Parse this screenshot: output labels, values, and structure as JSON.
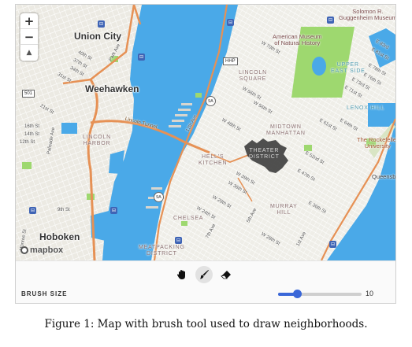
{
  "map": {
    "zoom_in": "+",
    "zoom_out": "−",
    "compass": "▲",
    "attribution": "mapbox",
    "labels": {
      "union_city": "Union City",
      "weehawken": "Weehawken",
      "hoboken": "Hoboken",
      "lincoln_tunnel": "Lincoln Tunnel",
      "lincoln_harbor": "LINCOLN\nHARBOR",
      "lincoln_square": "LINCOLN\nSQUARE",
      "upper_east_side": "UPPER\nEAST SIDE",
      "lenox_hill": "LENOX HILL",
      "midtown_manhattan": "MIDTOWN\nMANHATTAN",
      "theater_district": "THEATER\nDISTRICT",
      "hells_kitchen": "HELL'S\nKITCHEN",
      "murray_hill": "MURRAY\nHILL",
      "chelsea": "CHELSEA",
      "meatpacking_district": "MEATPACKING\nDISTRICT",
      "american_museum": "American Museum\nof Natural History",
      "guggenheim": "Solomon R.\nGuggenheim Museum",
      "rockefeller_university": "The Rockefeller\nUniversity",
      "queensbridge": "Queensb",
      "twelfth_ave": "12th Ave",
      "seventh_ave": "7th Ave",
      "fifth_ave": "5th Ave",
      "first_ave": "1st Ave",
      "park_ave": "Park Ave",
      "palisade_ave": "Palisade Ave",
      "monroe_st": "Monroe St",
      "s_40th": "40th St",
      "s_37th": "37th St",
      "s_34th": "34th St",
      "s_31st": "31st St",
      "s_21st": "21st St",
      "s_16th": "16th St",
      "s_14th": "14th St",
      "s_12th": "12th St",
      "s_9th": "9th St",
      "s_w70th": "W 70th St",
      "s_w66th": "W 66th St",
      "s_w56th": "W 56th St",
      "s_w48th": "W 48th St",
      "s_w39th": "W 39th St",
      "s_w36th": "W 36th St",
      "s_w29th": "W 29th St",
      "s_w24th": "W 24th St",
      "s_w28th": "W 28th St",
      "s_e83rd": "E 83rd",
      "s_e81st": "E 81st St",
      "s_e78th": "E 78th St",
      "s_e76th": "E 76th St",
      "s_e73rd": "E 73rd St",
      "s_e71st": "E 71st St",
      "s_e64th": "E 64th St",
      "s_e61st": "E 61st St",
      "s_e52nd": "E 52nd St",
      "s_e47th": "E 47th St",
      "s_e36th": "E 36th St",
      "shield_9a": "9A",
      "shield_501": "501",
      "shield_hhp": "HHP"
    },
    "colors": {
      "water": "#4aa9e8",
      "land": "#efeee8",
      "park": "#9ed86f",
      "highway": "#e69155",
      "brush": "#3d3d3d"
    }
  },
  "toolbar": {
    "tools": [
      {
        "name": "pan",
        "icon": "hand-icon"
      },
      {
        "name": "brush",
        "icon": "brush-icon",
        "active": true
      },
      {
        "name": "eraser",
        "icon": "eraser-icon"
      }
    ],
    "brush_size_label": "BRUSH SIZE",
    "brush_size_value": "10",
    "brush_size_fraction": 0.23
  },
  "caption": "Figure 1: Map with brush tool used to draw neighborhoods."
}
